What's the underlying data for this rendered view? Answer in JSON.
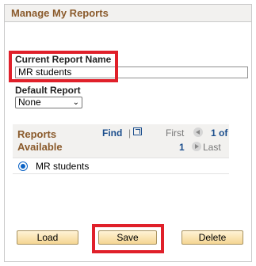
{
  "panel": {
    "title": "Manage My Reports"
  },
  "form": {
    "current_report_name_label": "Current Report Name",
    "current_report_name_value": "MR students",
    "default_report_label": "Default Report",
    "default_report_selected": "None"
  },
  "grid": {
    "title_line1": "Reports",
    "title_line2": "Available",
    "find_label": "Find",
    "separator": "|",
    "first_label": "First",
    "range_start": "1",
    "range_of": "of",
    "range_total": "1",
    "last_label": "Last",
    "rows": [
      {
        "name": "MR students",
        "selected": true
      }
    ]
  },
  "buttons": {
    "load": "Load",
    "save": "Save",
    "delete": "Delete"
  },
  "highlight_color": "#e0202a"
}
